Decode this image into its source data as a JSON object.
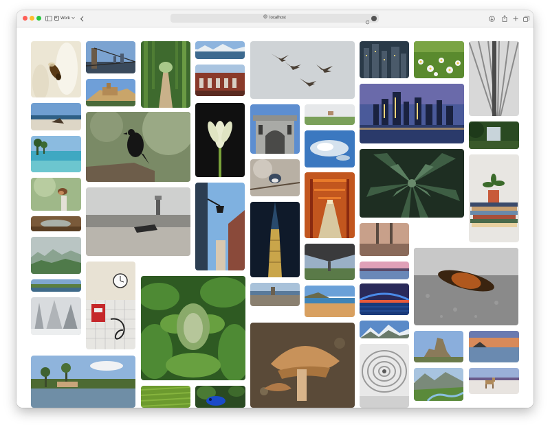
{
  "browser": {
    "tab_group_label": "Work",
    "url": "localhost"
  },
  "icons": [
    "sidebar-icon",
    "tab-group-icon",
    "chevron-down-icon",
    "back-icon",
    "lock-icon",
    "reload-icon",
    "extension-icon",
    "download-icon",
    "share-icon",
    "new-tab-icon",
    "tab-overview-icon"
  ],
  "colors": {
    "close": "#fe5f57",
    "minimize": "#febc2e",
    "zoom": "#28c840",
    "toolbar": "#f3f3f3",
    "url_field": "#e3e3e3"
  },
  "gallery": {
    "photos": [
      "bee-on-white-flower",
      "brooklyn-bridge-skyline",
      "bamboo-forest-path",
      "snowy-mountain-lake",
      "flying-pelicans-sky",
      "city-lights-at-dusk",
      "white-daisies-field",
      "white-architecture-ribs",
      "hilltop-castle-town",
      "red-brick-building",
      "beach-with-driftwood",
      "black-crow-on-branch",
      "white-flower-bud-dark",
      "ornate-stone-gateway",
      "horse-on-green-hill",
      "london-skyline-night",
      "tropical-beach-palms",
      "snowy-island-aerial",
      "bird-on-branch",
      "green-agave-plant",
      "trees-and-building",
      "potted-plant-on-books",
      "small-bird-on-post",
      "beach-seascape",
      "street-lamp-wall",
      "red-torii-tunnel",
      "skyscraper-at-night",
      "foggy-green-forest",
      "wooden-window-view",
      "pink-sunset-water",
      "coastal-village",
      "wall-clock-and-fire-alarm",
      "fern-leaves-closeup",
      "glowing-bridge-night",
      "sandy-beach-cliffs",
      "woolly-caterpillar",
      "under-bridge-view",
      "red-boat-on-shore",
      "frozen-winter-trees",
      "brown-mushroom",
      "snowy-mountain-peaks",
      "rock-formation",
      "sunset-over-sea",
      "spiral-architecture",
      "palm-house-waterfront",
      "green-tea-field",
      "blue-poison-frog",
      "mountain-river-valley",
      "dog-on-salt-flat",
      "dark-forest-edge"
    ]
  }
}
